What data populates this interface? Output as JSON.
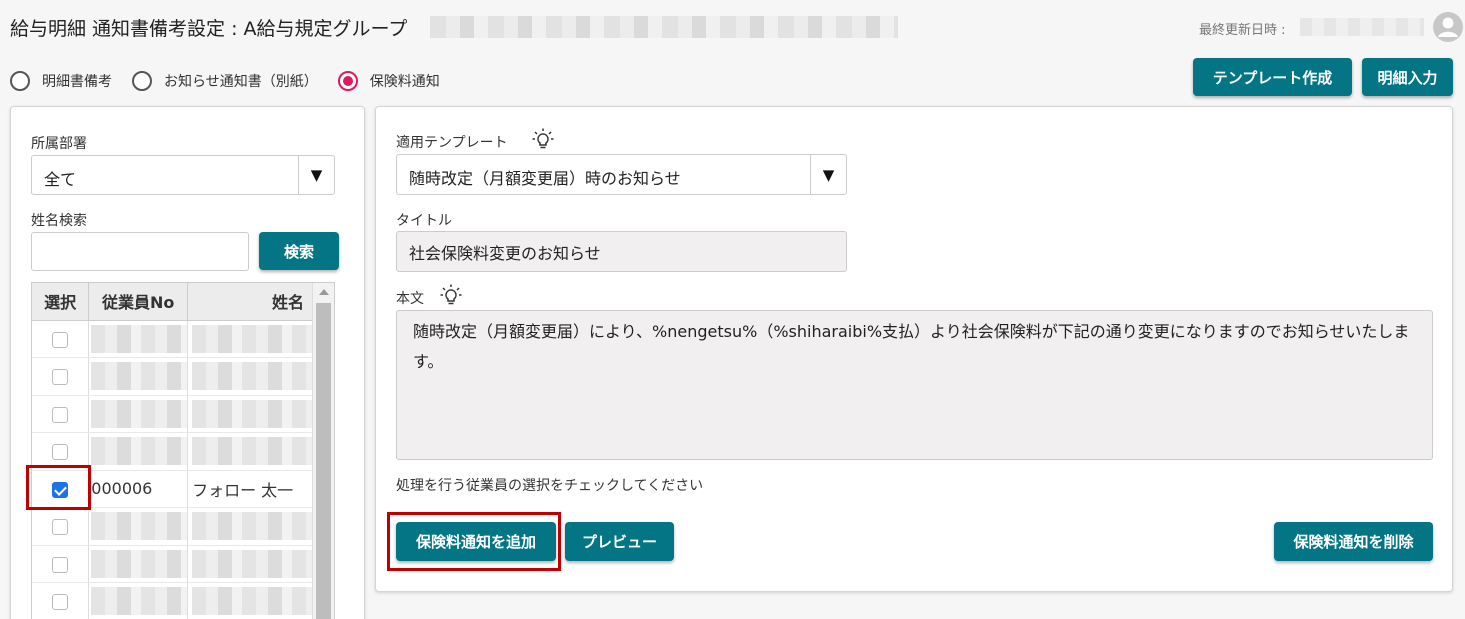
{
  "header": {
    "title": "給与明細 通知書備考設定 : A給与規定グループ",
    "updated_label": "最終更新日時 :"
  },
  "radios": [
    {
      "label": "明細書備考",
      "selected": false
    },
    {
      "label": "お知らせ通知書（別紙）",
      "selected": false
    },
    {
      "label": "保険料通知",
      "selected": true
    }
  ],
  "toolbar": {
    "template_create": "テンプレート作成",
    "detail_input": "明細入力"
  },
  "left": {
    "dept_label": "所属部署",
    "dept_value": "全て",
    "name_search_label": "姓名検索",
    "name_search_value": "",
    "search_button": "検索",
    "table": {
      "headers": [
        "選択",
        "従業員No",
        "姓名"
      ],
      "rows": [
        {
          "checked": false,
          "no": "",
          "name": ""
        },
        {
          "checked": false,
          "no": "",
          "name": ""
        },
        {
          "checked": false,
          "no": "",
          "name": ""
        },
        {
          "checked": false,
          "no": "",
          "name": ""
        },
        {
          "checked": true,
          "no": "000006",
          "name": "フォロー 太一"
        },
        {
          "checked": false,
          "no": "",
          "name": ""
        },
        {
          "checked": false,
          "no": "",
          "name": ""
        },
        {
          "checked": false,
          "no": "",
          "name": ""
        }
      ]
    }
  },
  "right": {
    "template_label": "適用テンプレート",
    "template_value": "随時改定（月額変更届）時のお知らせ",
    "title_label": "タイトル",
    "title_value": "社会保険料変更のお知らせ",
    "body_label": "本文",
    "body_value": "随時改定（月額変更届）により、%nengetsu%（%shiharaibi%支払）より社会保険料が下記の通り変更になりますのでお知らせいたします。",
    "hint": "処理を行う従業員の選択をチェックしてください",
    "add_button": "保険料通知を追加",
    "preview_button": "プレビュー",
    "delete_button": "保険料通知を削除"
  },
  "colors": {
    "button": "#047585",
    "radio_selected": "#e0195f",
    "highlight": "#c00000",
    "checkbox": "#1a73e8"
  }
}
